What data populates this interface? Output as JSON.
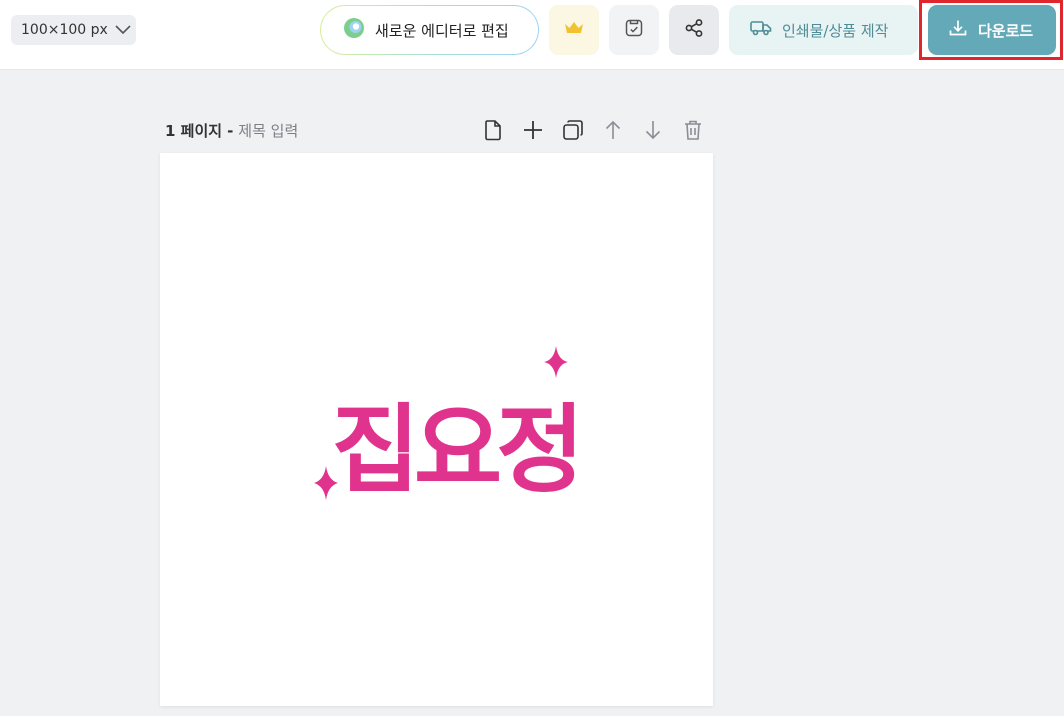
{
  "toolbar": {
    "size_select": {
      "value": "100×100 px",
      "icon": "chevron-down-icon"
    },
    "new_editor": {
      "label": "새로운 에디터로 편집",
      "icon": "editor-logo-icon"
    },
    "premium": {
      "icon": "crown-icon",
      "color": "#f2c230"
    },
    "save": {
      "icon": "save-check-icon"
    },
    "share": {
      "icon": "share-icon"
    },
    "print": {
      "label": "인쇄물/상품 제작",
      "icon": "truck-icon",
      "color": "#4f8d96"
    },
    "download": {
      "label": "다운로드",
      "icon": "download-icon",
      "color": "#63a9b7"
    }
  },
  "page": {
    "number_label": "1 페이지",
    "separator": "-",
    "title_placeholder": "제목 입력",
    "tools": [
      {
        "name": "page-icon"
      },
      {
        "name": "add-icon"
      },
      {
        "name": "duplicate-icon"
      },
      {
        "name": "move-up-icon"
      },
      {
        "name": "move-down-icon"
      },
      {
        "name": "trash-icon"
      }
    ]
  },
  "canvas": {
    "logo_text": "집요정",
    "logo_color": "#e0338e"
  },
  "colors": {
    "highlight_frame": "#e0252c",
    "background": "#f0f1f3"
  }
}
